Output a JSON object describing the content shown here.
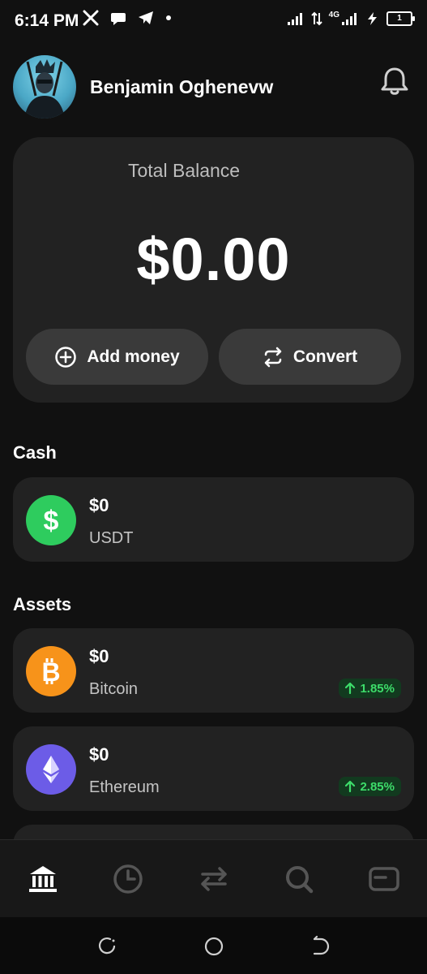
{
  "status_bar": {
    "time": "6:14 PM",
    "network": "4G",
    "battery": "1",
    "icons": [
      "x-icon",
      "chat-icon",
      "telegram-icon",
      "dot-icon",
      "signal-icon",
      "data-arrows-icon",
      "signal-4g-icon",
      "charging-icon",
      "battery-icon"
    ]
  },
  "header": {
    "user_name": "Benjamin Oghenevw",
    "avatar_icon": "avatar",
    "bell_icon": "bell-icon"
  },
  "balance": {
    "label": "Total Balance",
    "amount": "$0.00",
    "add_money_label": "Add money",
    "convert_label": "Convert"
  },
  "cash": {
    "title": "Cash",
    "items": [
      {
        "amount": "$0",
        "name": "USDT",
        "icon": "dollar-icon",
        "color": "#2ecc5e"
      }
    ]
  },
  "assets": {
    "title": "Assets",
    "items": [
      {
        "amount": "$0",
        "name": "Bitcoin",
        "change": "1.85%",
        "icon": "bitcoin-icon",
        "color": "#f7931a"
      },
      {
        "amount": "$0",
        "name": "Ethereum",
        "change": "2.85%",
        "icon": "ethereum-icon",
        "color": "#6c5ce7"
      }
    ]
  },
  "bottom_nav": {
    "items": [
      "home-bank-icon",
      "history-clock-icon",
      "transfer-arrows-icon",
      "search-icon",
      "card-icon"
    ]
  },
  "colors": {
    "background": "#111111",
    "card": "#222222",
    "button": "#3a3a3a",
    "positive": "#3ddc6a"
  }
}
